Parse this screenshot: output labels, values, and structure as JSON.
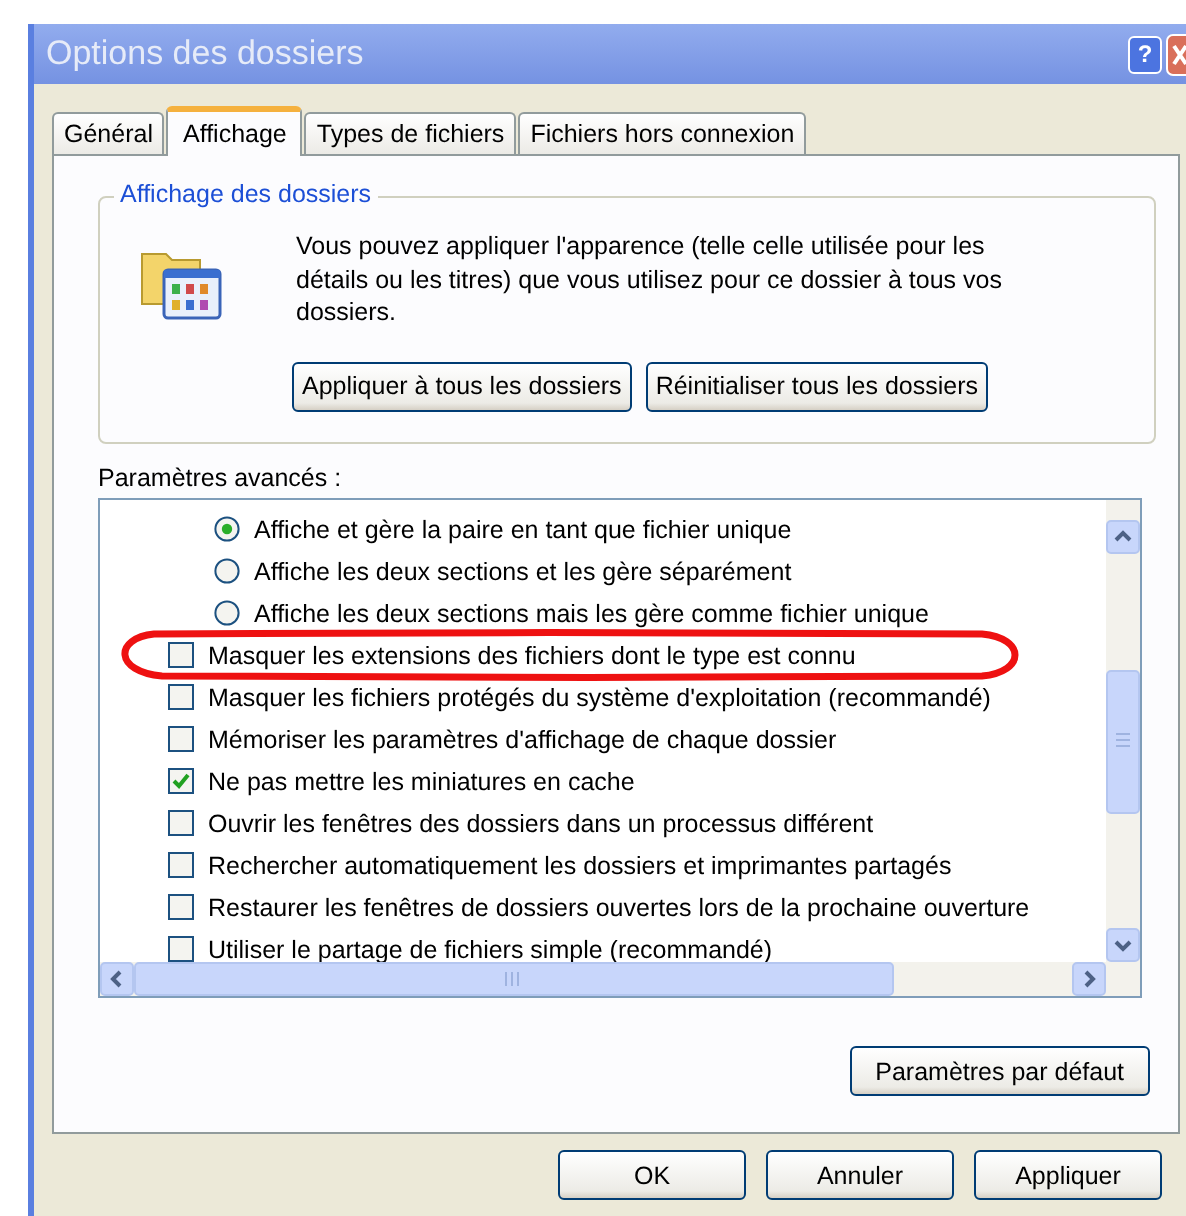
{
  "window": {
    "title": "Options des dossiers",
    "help_button": "?"
  },
  "tabs": [
    {
      "label": "Général",
      "selected": false
    },
    {
      "label": "Affichage",
      "selected": true
    },
    {
      "label": "Types de fichiers",
      "selected": false
    },
    {
      "label": "Fichiers hors connexion",
      "selected": false
    }
  ],
  "folder_view": {
    "title": "Affichage des dossiers",
    "description": "Vous pouvez appliquer l'apparence (telle celle utilisée pour les détails ou les titres) que vous utilisez pour ce dossier à tous vos dossiers.",
    "buttons": [
      "Appliquer à tous les dossiers",
      "Réinitialiser tous les dossiers"
    ]
  },
  "advanced": {
    "label": "Paramètres avancés :",
    "items": [
      {
        "kind": "radio",
        "label": "Affiche et gère la paire en tant que fichier unique",
        "checked": true
      },
      {
        "kind": "radio",
        "label": "Affiche les deux sections et les gère séparément",
        "checked": false
      },
      {
        "kind": "radio",
        "label": "Affiche les deux sections mais les gère comme fichier unique",
        "checked": false
      },
      {
        "kind": "checkbox",
        "label": "Masquer les extensions des fichiers dont le type est connu",
        "checked": false
      },
      {
        "kind": "checkbox",
        "label": "Masquer les fichiers protégés du système d'exploitation (recommandé)",
        "checked": false
      },
      {
        "kind": "checkbox",
        "label": "Mémoriser les paramètres d'affichage de chaque dossier",
        "checked": false
      },
      {
        "kind": "checkbox",
        "label": "Ne pas mettre les miniatures en cache",
        "checked": true
      },
      {
        "kind": "checkbox",
        "label": "Ouvrir les fenêtres des dossiers dans un processus différent",
        "checked": false
      },
      {
        "kind": "checkbox",
        "label": "Rechercher automatiquement les dossiers et imprimantes partagés",
        "checked": false
      },
      {
        "kind": "checkbox",
        "label": "Restaurer les fenêtres de dossiers ouvertes lors de la prochaine ouverture",
        "checked": false
      },
      {
        "kind": "checkbox",
        "label": "Utiliser le partage de fichiers simple (recommandé)",
        "checked": false
      }
    ],
    "default_button": "Paramètres par défaut"
  },
  "buttons": [
    "OK",
    "Annuler",
    "Appliquer"
  ]
}
